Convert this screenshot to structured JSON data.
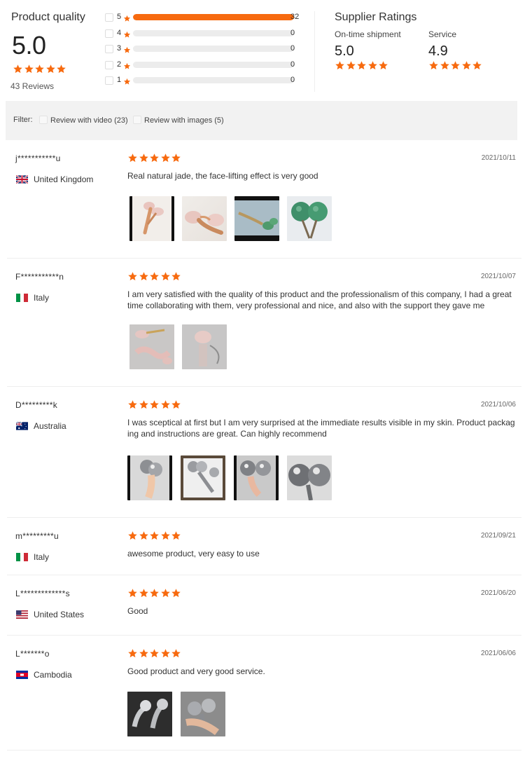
{
  "colors": {
    "accent": "#f76a0f",
    "track": "#ececec",
    "filter_bg": "#f2f2f2"
  },
  "product_quality": {
    "title": "Product quality",
    "score": "5.0",
    "stars": 5,
    "reviews_text": "43 Reviews",
    "histogram": [
      {
        "star": "5",
        "count": "32",
        "fraction": 1.0
      },
      {
        "star": "4",
        "count": "0",
        "fraction": 0
      },
      {
        "star": "3",
        "count": "0",
        "fraction": 0
      },
      {
        "star": "2",
        "count": "0",
        "fraction": 0
      },
      {
        "star": "1",
        "count": "0",
        "fraction": 0
      }
    ]
  },
  "supplier": {
    "title": "Supplier Ratings",
    "metrics": [
      {
        "label": "On-time shipment",
        "value": "5.0",
        "stars": 5
      },
      {
        "label": "Service",
        "value": "4.9",
        "stars": 5
      }
    ]
  },
  "filter": {
    "label": "Filter:",
    "options": [
      {
        "label": "Review with video (23)"
      },
      {
        "label": "Review with images (5)"
      }
    ]
  },
  "reviews": [
    {
      "user": "j***********u",
      "country": "United Kingdom",
      "flag_icon": "uk-flag-icon",
      "date": "2021/10/11",
      "stars": 5,
      "text": "Real natural jade, the face-lifting effect is very good",
      "images": [
        "rose-quartz-roller-photo",
        "rose-quartz-roller-photo",
        "jade-roller-photo",
        "green-jade-balls-photo"
      ]
    },
    {
      "user": "F***********n",
      "country": "Italy",
      "flag_icon": "italy-flag-icon",
      "date": "2021/10/07",
      "stars": 5,
      "text": "I am very satisfied with the quality of this product and the professionalism of this company, I had a great time collaborating with them, very professional and nice, and also with the support they gave me",
      "images": [
        "rose-quartz-set-photo",
        "rose-quartz-roller-photo"
      ]
    },
    {
      "user": "D*********k",
      "country": "Australia",
      "flag_icon": "australia-flag-icon",
      "date": "2021/10/06",
      "stars": 5,
      "text": "I was sceptical at first but I am very surprised at the immediate results visible in my skin. Product packaging and instructions are great. Can highly recommend",
      "images": [
        "metal-roller-photo",
        "metal-roller-photo",
        "metal-roller-photo",
        "metal-roller-photo"
      ]
    },
    {
      "user": "m*********u",
      "country": "Italy",
      "flag_icon": "italy-flag-icon",
      "date": "2021/09/21",
      "stars": 5,
      "text": "awesome product, very easy to use",
      "images": []
    },
    {
      "user": "L*************s",
      "country": "United States",
      "flag_icon": "us-flag-icon",
      "date": "2021/06/20",
      "stars": 5,
      "text": "Good",
      "images": []
    },
    {
      "user": "L*******o",
      "country": "Cambodia",
      "flag_icon": "cambodia-flag-icon",
      "date": "2021/06/06",
      "stars": 5,
      "text": "Good product and very good service.",
      "images": [
        "metal-roller-photo",
        "metal-roller-photo"
      ]
    }
  ]
}
